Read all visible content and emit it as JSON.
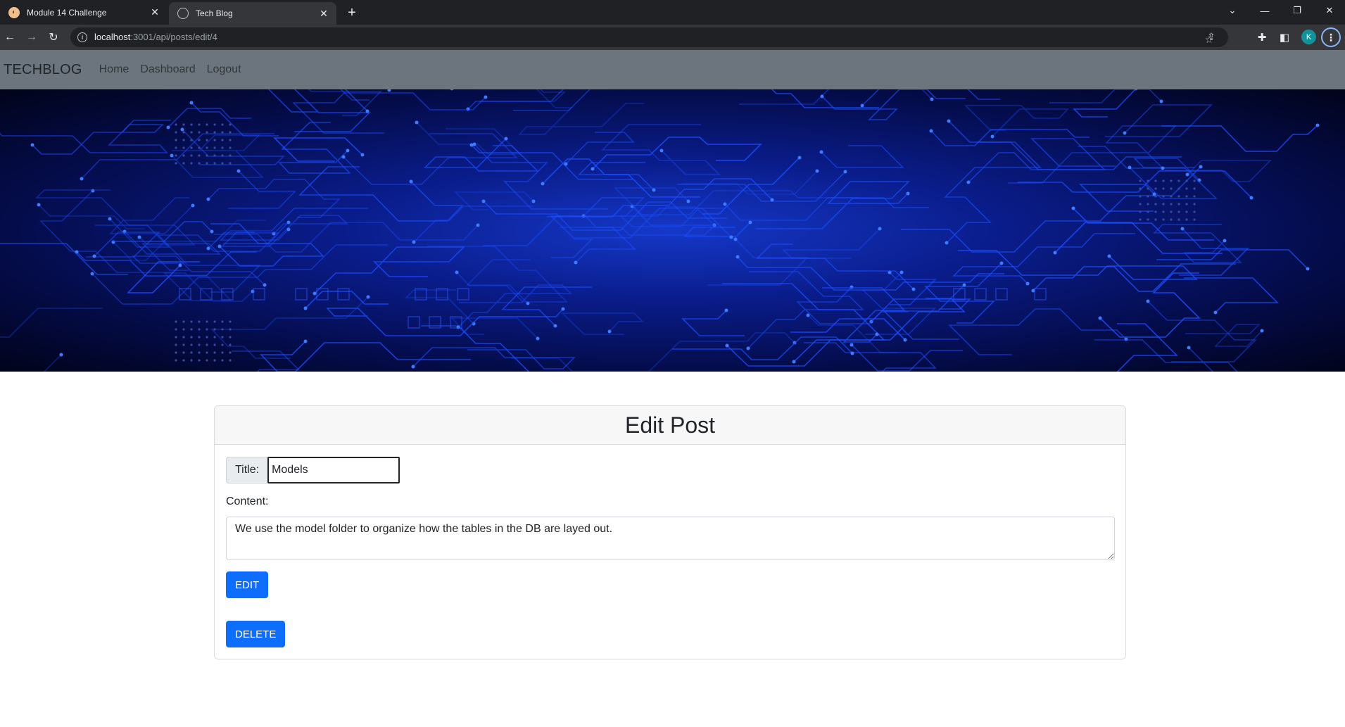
{
  "browser": {
    "tabs": [
      {
        "title": "Module 14 Challenge",
        "active": false
      },
      {
        "title": "Tech Blog",
        "active": true
      }
    ],
    "url_host": "localhost",
    "url_rest": ":3001/api/posts/edit/4",
    "profile_initial": "K"
  },
  "navbar": {
    "brand": "TECHBLOG",
    "links": [
      "Home",
      "Dashboard",
      "Logout"
    ]
  },
  "edit_post": {
    "heading": "Edit Post",
    "title_label": "Title:",
    "title_value": "Models",
    "content_label": "Content:",
    "content_value": "We use the model folder to organize how the tables in the DB are layed out.",
    "edit_button": "EDIT",
    "delete_button": "DELETE"
  },
  "colors": {
    "navbar_bg": "#6c757d",
    "button_primary": "#0d6efd",
    "hero_accent": "#1a4dff"
  }
}
